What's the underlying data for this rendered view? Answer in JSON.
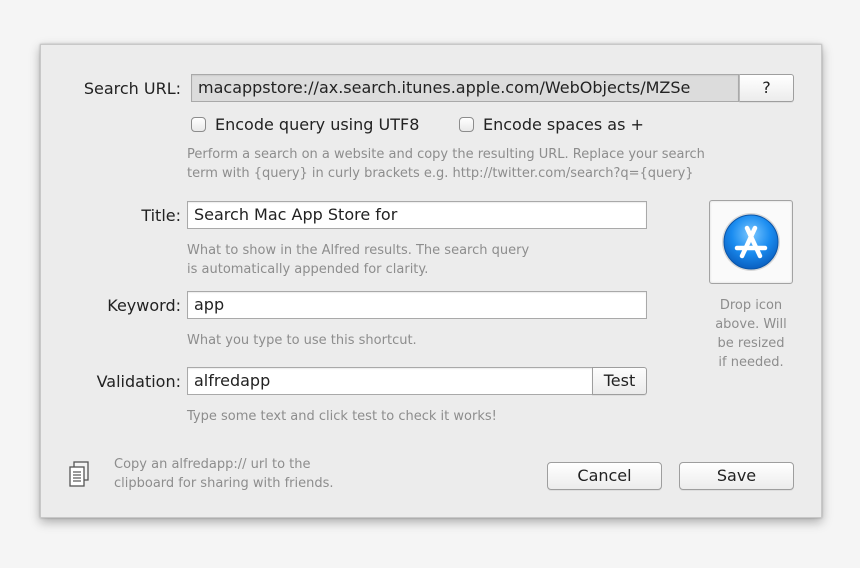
{
  "form": {
    "search_url_label": "Search URL:",
    "search_url_value": "macappstore://ax.search.itunes.apple.com/WebObjects/MZSe",
    "help_button": "?",
    "encode_utf8_label": "Encode query using UTF8",
    "encode_spaces_label": "Encode spaces as +",
    "url_hint_line1": "Perform a search on a website and copy the resulting URL. Replace your search",
    "url_hint_line2": "term with {query} in curly brackets e.g. http://twitter.com/search?q={query}",
    "title_label": "Title:",
    "title_value": "Search Mac App Store for",
    "title_hint_line1": "What to show in the Alfred results. The search query",
    "title_hint_line2": "is automatically appended for clarity.",
    "keyword_label": "Keyword:",
    "keyword_value": "app",
    "keyword_hint": "What you type to use this shortcut.",
    "validation_label": "Validation:",
    "validation_value": "alfredapp",
    "test_button": "Test",
    "validation_hint": "Type some text and click test to check it works!"
  },
  "icon_well": {
    "icon": "app-store-icon",
    "drop_line1": "Drop icon",
    "drop_line2": "above. Will",
    "drop_line3": "be resized",
    "drop_line4": "if needed."
  },
  "footer": {
    "copy_icon": "copy-clipboard-icon",
    "copy_line1": "Copy an alfredapp:// url to the",
    "copy_line2": "clipboard for sharing with friends.",
    "cancel_button": "Cancel",
    "save_button": "Save"
  },
  "colors": {
    "dialog_bg": "#ececec",
    "hint_text": "#8d8d8d",
    "app_store_blue": "#1a8cf0"
  }
}
